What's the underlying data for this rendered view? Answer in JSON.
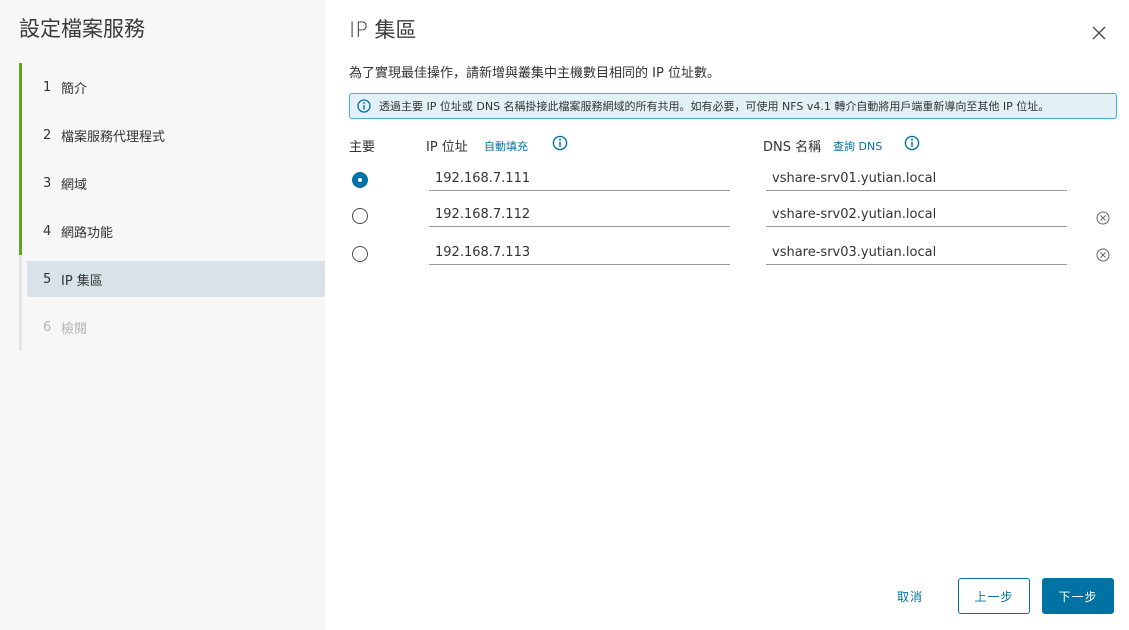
{
  "sidebar": {
    "title": "設定檔案服務",
    "steps": [
      {
        "num": "1",
        "label": "簡介",
        "state": "done"
      },
      {
        "num": "2",
        "label": "檔案服務代理程式",
        "state": "done"
      },
      {
        "num": "3",
        "label": "網域",
        "state": "done"
      },
      {
        "num": "4",
        "label": "網路功能",
        "state": "done"
      },
      {
        "num": "5",
        "label": "IP 集區",
        "state": "active"
      },
      {
        "num": "6",
        "label": "檢閱",
        "state": "pending"
      }
    ]
  },
  "main": {
    "title": "IP 集區",
    "description": "為了實現最佳操作，請新增與叢集中主機數目相同的 IP 位址數。",
    "info_banner": "透過主要 IP 位址或 DNS 名稱掛接此檔案服務網域的所有共用。如有必要，可使用 NFS v4.1 轉介自動將用戶端重新導向至其他 IP 位址。",
    "columns": {
      "primary": "主要",
      "ip": "IP 位址",
      "autofill": "自動填充",
      "dns": "DNS 名稱",
      "lookup_dns": "查詢 DNS"
    },
    "rows": [
      {
        "primary": true,
        "ip": "192.168.7.111",
        "dns": "vshare-srv01.yutian.local",
        "removable": false
      },
      {
        "primary": false,
        "ip": "192.168.7.112",
        "dns": "vshare-srv02.yutian.local",
        "removable": true
      },
      {
        "primary": false,
        "ip": "192.168.7.113",
        "dns": "vshare-srv03.yutian.local",
        "removable": true
      }
    ]
  },
  "footer": {
    "cancel": "取消",
    "prev": "上一步",
    "next": "下一步"
  },
  "colors": {
    "accent": "#0072a3",
    "done_step": "#62a420",
    "active_step_bg": "#d8e3e9",
    "info_bg": "#e1f1f6"
  }
}
